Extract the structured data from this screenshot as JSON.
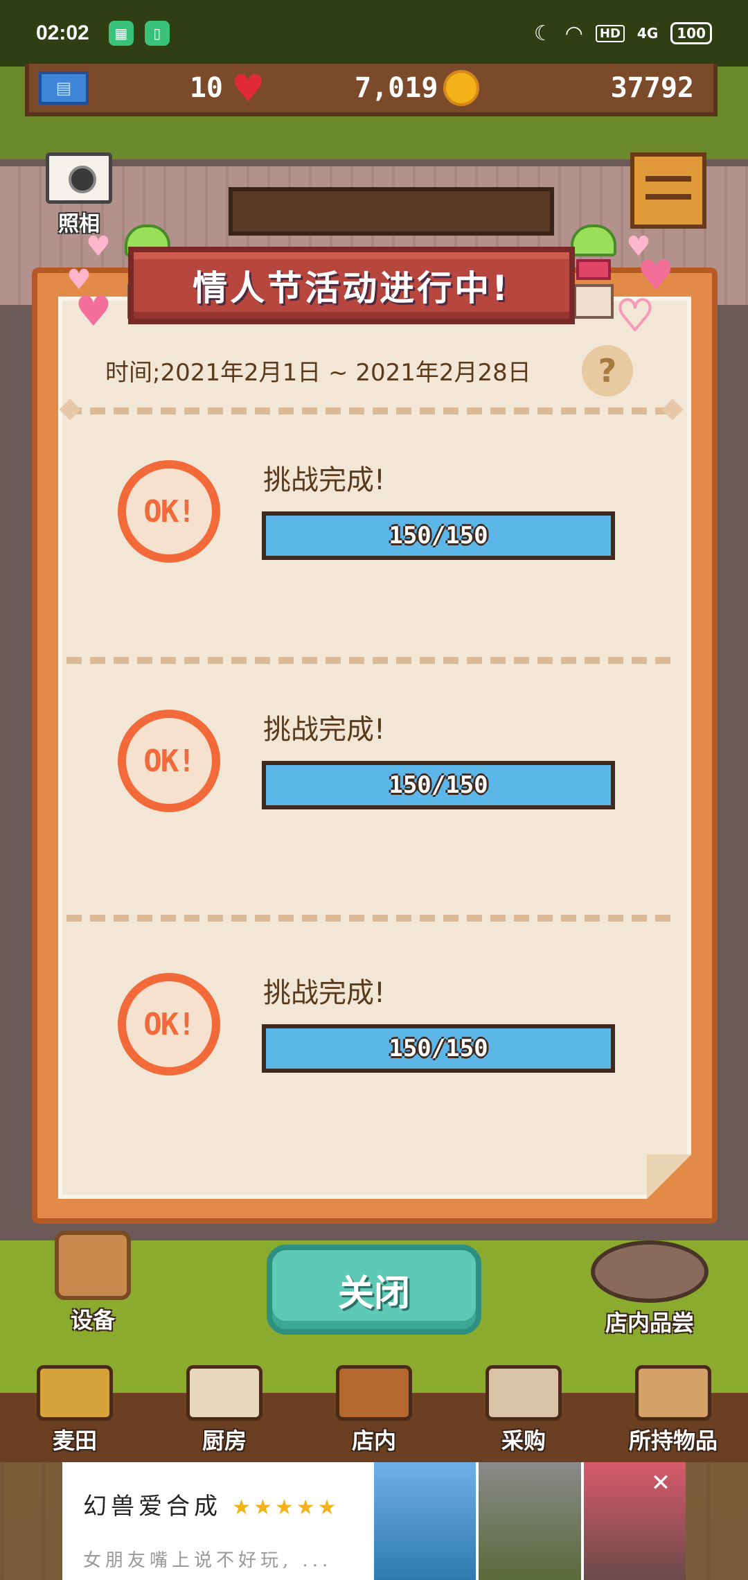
{
  "status_bar": {
    "time": "02:02",
    "hd": "HD",
    "network": "4G",
    "battery": "100"
  },
  "resources": {
    "hearts": "10",
    "coins": "7,019",
    "gems": "37792"
  },
  "scene": {
    "photo_label": "照相",
    "equipment_label": "设备",
    "tasting_label": "店内品尝"
  },
  "modal": {
    "title": "情人节活动进行中!",
    "date_range": "时间;2021年2月1日 ~ 2021年2月28日",
    "help_symbol": "?",
    "challenges": [
      {
        "status": "挑战完成!",
        "stamp": "OK!",
        "progress_text": "150/150",
        "progress_fraction": 1.0
      },
      {
        "status": "挑战完成!",
        "stamp": "OK!",
        "progress_text": "150/150",
        "progress_fraction": 1.0
      },
      {
        "status": "挑战完成!",
        "stamp": "OK!",
        "progress_text": "150/150",
        "progress_fraction": 1.0
      }
    ],
    "close_label": "关闭"
  },
  "bottom_nav": {
    "items": [
      {
        "label": "麦田",
        "color": "#d8a23a"
      },
      {
        "label": "厨房",
        "color": "#e9d8c0"
      },
      {
        "label": "店内",
        "color": "#b5682e"
      },
      {
        "label": "采购",
        "color": "#d9c2a6"
      },
      {
        "label": "所持物品",
        "color": "#d4a06a"
      }
    ]
  },
  "ad": {
    "title": "幻兽爱合成",
    "rating_stars": "★★★★★",
    "description": "女朋友嘴上说不好玩, ...",
    "close_symbol": "✕"
  },
  "colors": {
    "modal_border": "#e28a47",
    "title_banner": "#b7463e",
    "progress_fill": "#5db6e8",
    "stamp": "#f26a3a",
    "close_button": "#5ec9b4"
  }
}
